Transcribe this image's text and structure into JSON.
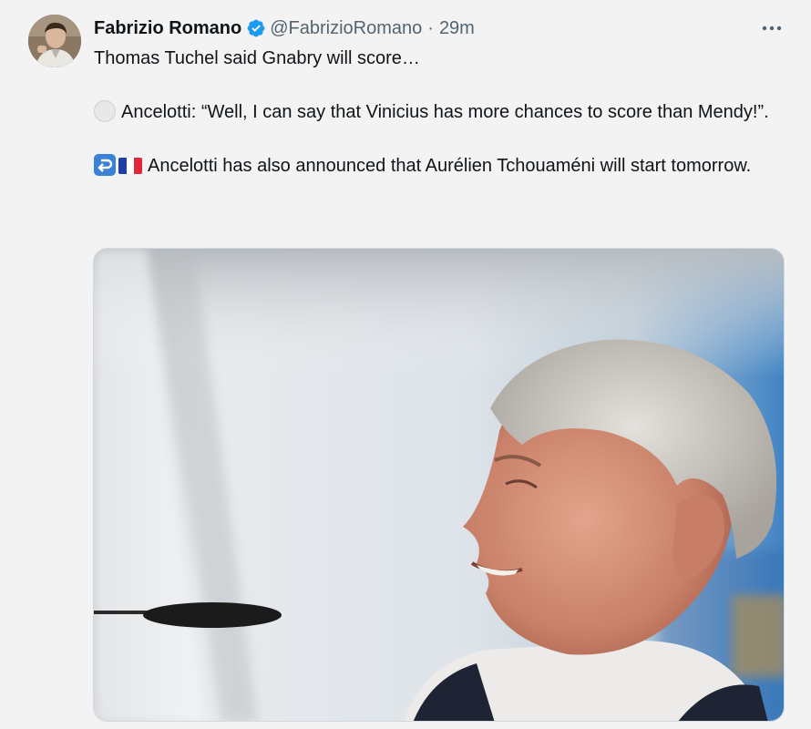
{
  "author": {
    "display_name": "Fabrizio Romano",
    "handle": "@FabrizioRomano",
    "separator": "·",
    "time": "29m",
    "verified": true
  },
  "tweet": {
    "line1": "Thomas Tuchel said Gnabry will score…",
    "line2": "Ancelotti: “Well, I can say that Vinicius has more chances to score than Mendy!”.",
    "line3": "Ancelotti has also announced that Aurélien Tchouaméni will start tomorrow."
  },
  "icons": {
    "verified": "verified-badge-icon",
    "more": "more-options-icon",
    "white_circle": "white-circle-emoji",
    "arrow": "right-arrow-curving-left-emoji",
    "flag": "france-flag-emoji"
  },
  "colors": {
    "verified_blue": "#1d9bf0",
    "text": "#0f1419",
    "secondary_text": "#536471",
    "background": "#f3f3f3"
  }
}
